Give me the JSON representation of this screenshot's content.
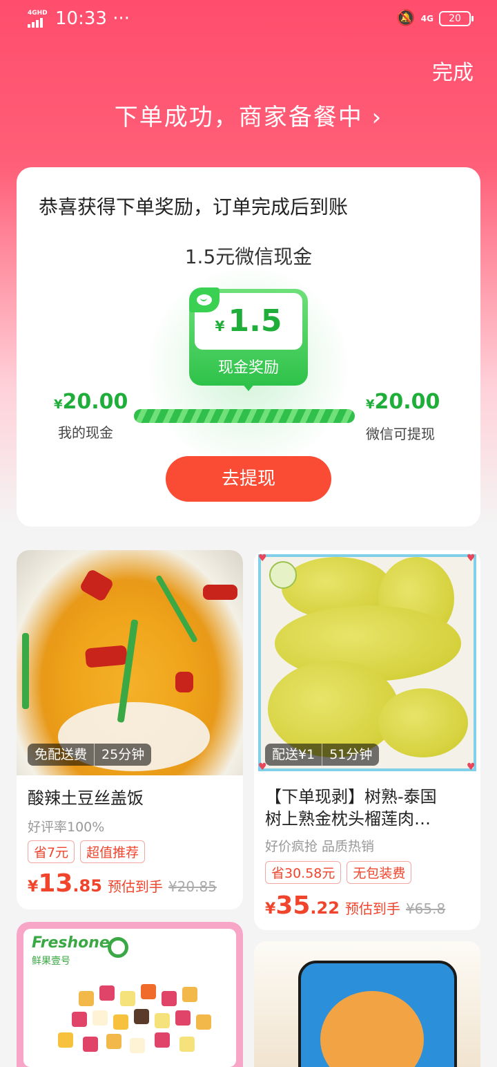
{
  "status_bar": {
    "network": "4GHD",
    "time": "10:33",
    "more": "···",
    "right_network": "4G",
    "battery": "20"
  },
  "header": {
    "done_label": "完成",
    "order_status": "下单成功，商家备餐中 ›"
  },
  "reward": {
    "title": "恭喜获得下单奖励，订单完成后到账",
    "subtitle": "1.5元微信现金",
    "coupon_currency": "¥",
    "coupon_amount": "1.5",
    "coupon_label": "现金奖励",
    "my_cash_currency": "¥",
    "my_cash_value": "20.00",
    "my_cash_label": "我的现金",
    "wechat_cash_currency": "¥",
    "wechat_cash_value": "20.00",
    "wechat_cash_label": "微信可提现",
    "withdraw_button": "去提现",
    "progress_fraction": 1.0,
    "accent_color": "#2fbf4a",
    "button_color": "#fa4b34"
  },
  "products": [
    {
      "image_icon": "food-photo-potato-rice",
      "badge_delivery": "免配送费",
      "badge_time": "25分钟",
      "name": "酸辣土豆丝盖饭",
      "subtitle": "好评率100%",
      "tags": [
        "省7元",
        "超值推荐"
      ],
      "price_currency": "¥",
      "price_int": "13",
      "price_dec": ".85",
      "price_note": "预估到手",
      "price_old": "¥20.85"
    },
    {
      "image_icon": "food-photo-durian",
      "badge_delivery": "配送¥1",
      "badge_time": "51分钟",
      "name_line1": "【下单现剥】树熟-泰国",
      "name_line2": "树上熟金枕头榴莲肉…",
      "subtitle": "好价疯抢 品质热销",
      "tags": [
        "省30.58元",
        "无包装费"
      ],
      "price_currency": "¥",
      "price_int": "35",
      "price_dec": ".22",
      "price_note": "预估到手",
      "price_old": "¥65.8"
    },
    {
      "image_icon": "food-photo-fruit-box",
      "brand_name": "Freshone",
      "brand_sub": "鲜果壹号"
    },
    {
      "image_icon": "product-photo-cat-phone-case"
    }
  ]
}
